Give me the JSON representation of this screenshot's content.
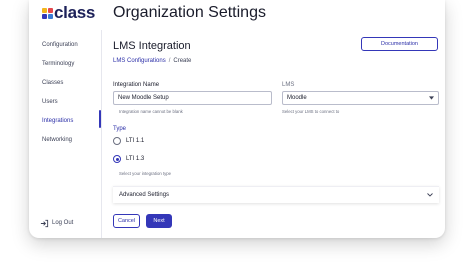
{
  "app": {
    "logo_text": "class",
    "logo_colors": [
      "#f3b51c",
      "#e5484d",
      "#3437b8",
      "#3a7bd5"
    ],
    "page_title": "Organization Settings"
  },
  "sidebar": {
    "items": [
      {
        "label": "Configuration"
      },
      {
        "label": "Terminology"
      },
      {
        "label": "Classes"
      },
      {
        "label": "Users"
      },
      {
        "label": "Integrations",
        "active": true
      },
      {
        "label": "Networking"
      }
    ],
    "logout_label": "Log Out"
  },
  "main": {
    "section_title": "LMS Integration",
    "documentation_label": "Documentation",
    "breadcrumb": {
      "parent": "LMS Configurations",
      "separator": "/",
      "current": "Create"
    },
    "integration_name": {
      "label": "Integration Name",
      "value": "New Moodle Setup",
      "help": "Integration name cannot be blank"
    },
    "lms": {
      "label": "LMS",
      "value": "Moodle",
      "help": "Select your LMS to connect to"
    },
    "type": {
      "label": "Type",
      "options": [
        {
          "label": "LTI 1.1",
          "checked": false
        },
        {
          "label": "LTI 1.3",
          "checked": true
        }
      ],
      "help": "Select your integration type"
    },
    "advanced_label": "Advanced Settings",
    "cancel_label": "Cancel",
    "next_label": "Next"
  },
  "colors": {
    "accent": "#3437b8",
    "brand_text": "#1d2159"
  }
}
